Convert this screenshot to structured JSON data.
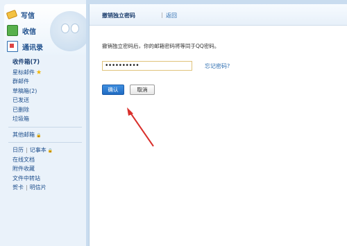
{
  "sidebar": {
    "top": [
      {
        "label": "写信",
        "icon": "pencil-icon"
      },
      {
        "label": "收信",
        "icon": "inbox-icon"
      },
      {
        "label": "通讯录",
        "icon": "address-book-icon"
      }
    ],
    "nav": {
      "inbox": "收件箱(7)",
      "starred": "星标邮件",
      "group": "群邮件",
      "drafts": "草稿箱(2)",
      "sent": "已发送",
      "deleted": "已删除",
      "spam": "垃圾箱",
      "other": "其他邮箱",
      "calendar": "日历",
      "notes": "记事本",
      "docs": "在线文档",
      "attachments": "附件收藏",
      "transfer": "文件中转站",
      "cards": "贺卡",
      "postcards": "明信片"
    }
  },
  "main": {
    "title": "撤销独立密码",
    "separator": "|",
    "back": "返回",
    "notice": "撤销独立密码后，你的邮箱密码将等同于QQ密码。",
    "password_value": "••••••••••",
    "forgot": "忘记密码?",
    "ok_label": "确认",
    "cancel_label": "取消"
  },
  "colors": {
    "accent": "#1f6bc2",
    "annotation_arrow": "#d9302c",
    "background": "#c9dcef"
  }
}
